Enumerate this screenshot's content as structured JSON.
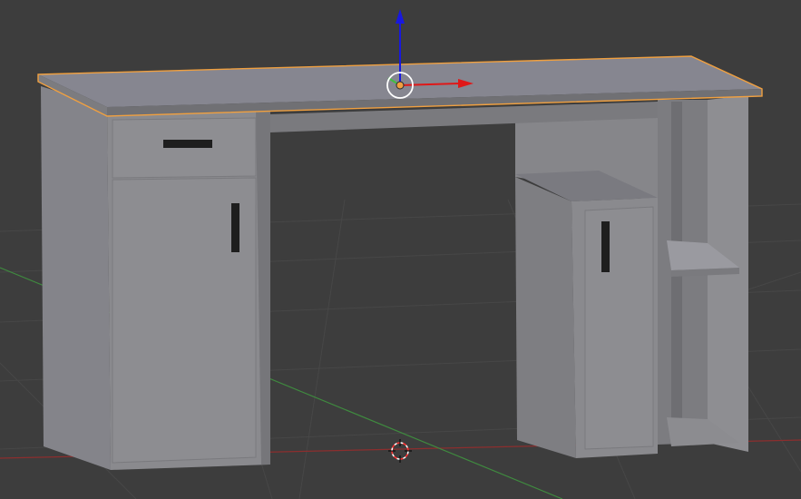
{
  "viewport": {
    "background": "#3d3d3d",
    "grid_color": "#474747",
    "axis_x_color": "#8c2e2e",
    "axis_y_color": "#3f8a3f"
  },
  "object": {
    "selected": true,
    "selection_outline_color": "#f0a040",
    "material_color": "#8a8a8e"
  },
  "gizmo": {
    "axis_x_color": "#e01818",
    "axis_y_color": "#40c040",
    "axis_z_color": "#1818e0",
    "origin_color": "#f0a040"
  },
  "cursor_3d": {
    "ring_colors": [
      "#ff3030",
      "#ffffff"
    ]
  }
}
